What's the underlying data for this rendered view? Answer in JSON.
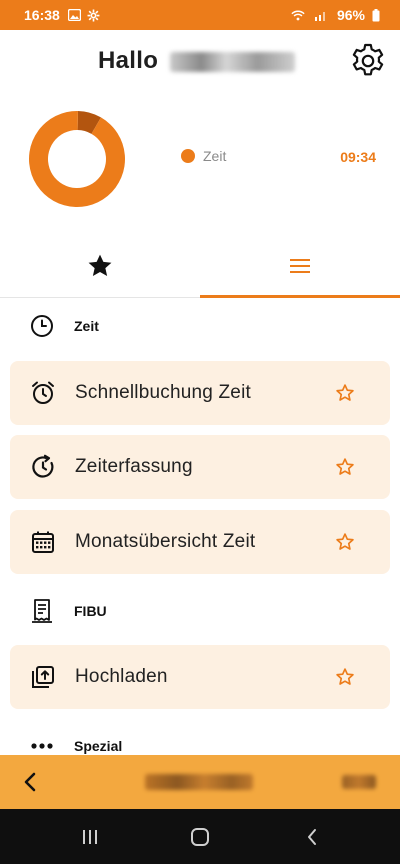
{
  "status_bar": {
    "time": "16:38",
    "battery": "96%"
  },
  "header": {
    "greeting": "Hallo"
  },
  "summary": {
    "chart_data": {
      "type": "pie",
      "variant": "donut",
      "slices": [
        {
          "label": "Zeit",
          "fraction": 0.08,
          "color": "#b3550f"
        },
        {
          "label": "",
          "fraction": 0.92,
          "color": "#ec7c1a"
        }
      ]
    },
    "legend": {
      "label": "Zeit",
      "value": "09:34",
      "color": "#ec7c1a"
    }
  },
  "tabs": [
    {
      "id": "favorites",
      "icon": "star-icon",
      "active": false
    },
    {
      "id": "all",
      "icon": "menu-icon",
      "active": true
    }
  ],
  "sections": [
    {
      "label": "Zeit",
      "icon": "clock-icon"
    },
    {
      "label": "FIBU",
      "icon": "receipt-icon"
    },
    {
      "label": "Spezial",
      "icon": "more-dots-icon"
    }
  ],
  "cards": [
    {
      "label": "Schnellbuchung Zeit",
      "icon": "alarm-clock-icon"
    },
    {
      "label": "Zeiterfassung",
      "icon": "timer-refresh-icon"
    },
    {
      "label": "Monatsübersicht Zeit",
      "icon": "calendar-icon"
    },
    {
      "label": "Hochladen",
      "icon": "upload-icon"
    }
  ],
  "colors": {
    "accent": "#ec7c1a",
    "card_bg": "#fdf0e1",
    "bottom_bar": "#f3a83f"
  }
}
